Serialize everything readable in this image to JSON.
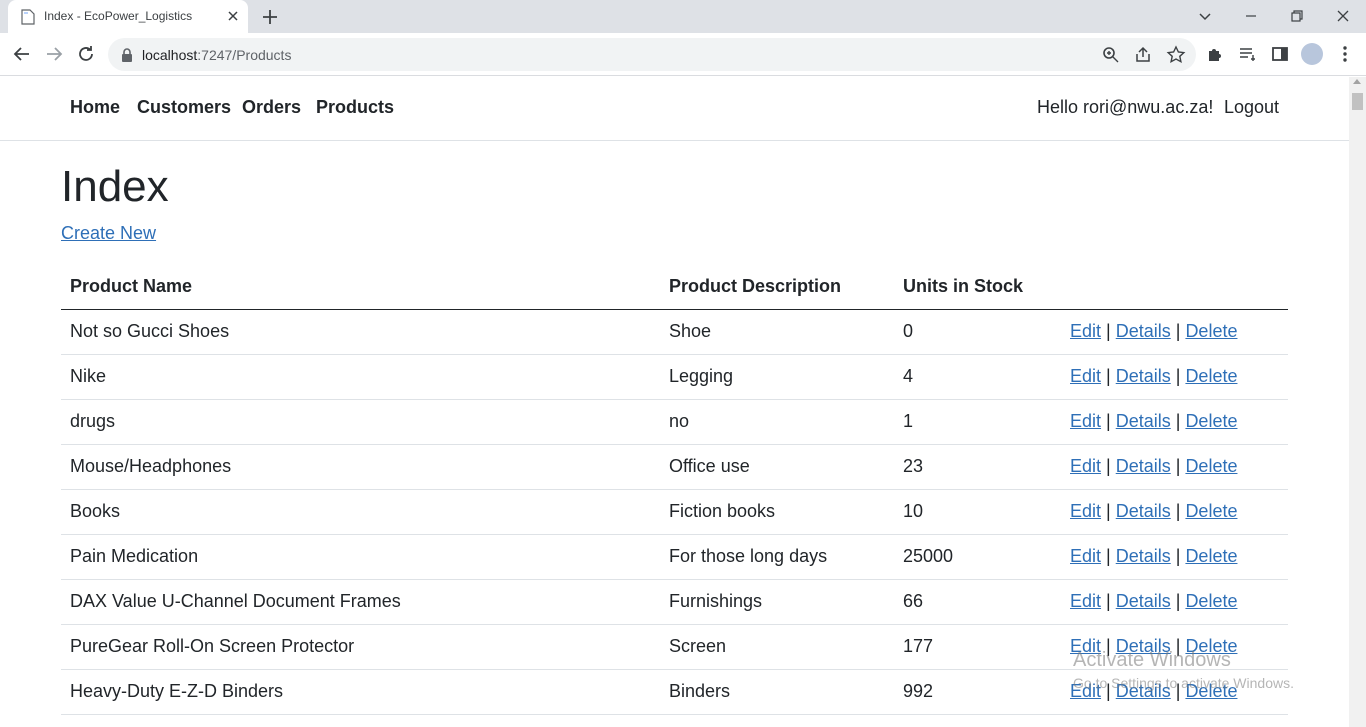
{
  "browser": {
    "tab_title": "Index - EcoPower_Logistics",
    "url_host": "localhost",
    "url_path": ":7247/Products"
  },
  "nav": {
    "items": [
      {
        "label": "Home"
      },
      {
        "label": "Customers"
      },
      {
        "label": "Orders"
      },
      {
        "label": "Products"
      }
    ],
    "greeting": "Hello rori@nwu.ac.za!",
    "logout": "Logout"
  },
  "page": {
    "title": "Index",
    "create_link": "Create New"
  },
  "table": {
    "headers": [
      "Product Name",
      "Product Description",
      "Units in Stock",
      ""
    ],
    "rows": [
      {
        "name": "Not so Gucci Shoes",
        "description": "Shoe",
        "units": "0"
      },
      {
        "name": "Nike",
        "description": "Legging",
        "units": "4"
      },
      {
        "name": "drugs",
        "description": "no",
        "units": "1"
      },
      {
        "name": "Mouse/Headphones",
        "description": "Office use",
        "units": "23"
      },
      {
        "name": "Books",
        "description": "Fiction books",
        "units": "10"
      },
      {
        "name": "Pain Medication",
        "description": "For those long days",
        "units": "25000"
      },
      {
        "name": "DAX Value U-Channel Document Frames",
        "description": "Furnishings",
        "units": "66"
      },
      {
        "name": "PureGear Roll-On Screen Protector",
        "description": "Screen",
        "units": "177"
      },
      {
        "name": "Heavy-Duty E-Z-D Binders",
        "description": "Binders",
        "units": "992"
      }
    ],
    "actions": {
      "edit": "Edit",
      "details": "Details",
      "delete": "Delete",
      "separator": "|"
    }
  },
  "watermark": {
    "line1": "Activate Windows",
    "line2": "Go to Settings to activate Windows."
  }
}
